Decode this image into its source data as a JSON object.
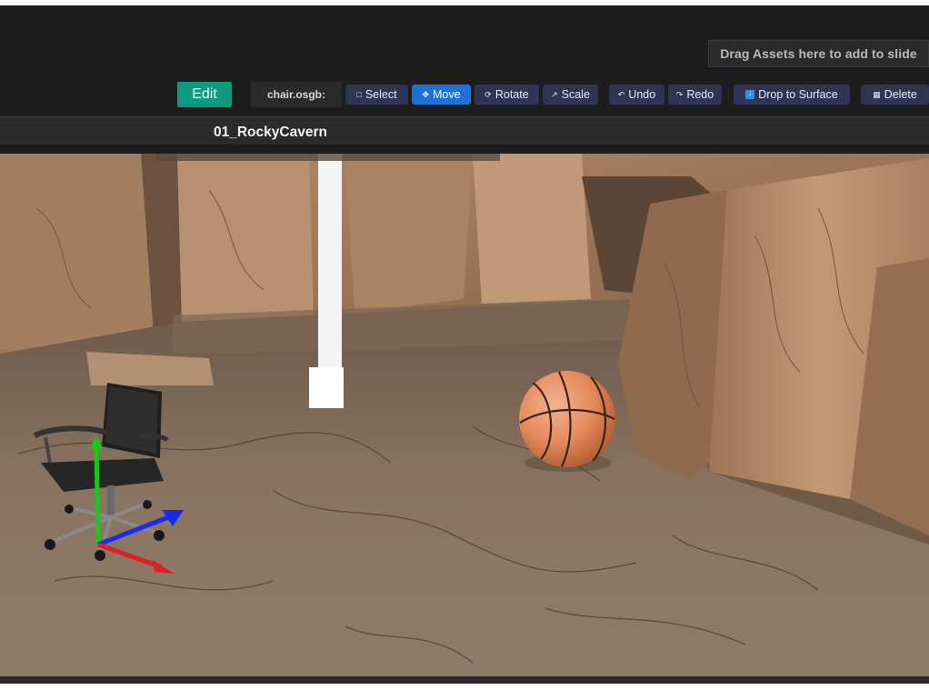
{
  "header": {
    "drop_zone_text": "Drag Assets here to add to slide"
  },
  "toolbar": {
    "edit_label": "Edit",
    "asset_name": "chair.osgb:",
    "buttons": [
      {
        "label": "Select",
        "icon": "select-box-icon"
      },
      {
        "label": "Move",
        "icon": "move-icon",
        "active": true
      },
      {
        "label": "Rotate",
        "icon": "rotate-icon"
      },
      {
        "label": "Scale",
        "icon": "scale-icon"
      },
      {
        "label": "Undo",
        "icon": "undo-icon"
      },
      {
        "label": "Redo",
        "icon": "redo-icon"
      },
      {
        "label": "Drop to Surface",
        "icon": "drop-to-surface-icon"
      },
      {
        "label": "Delete",
        "icon": "trash-icon"
      }
    ],
    "accent_color": "#0d9a80",
    "active_color": "#1c72d6",
    "button_color": "#2f3354"
  },
  "scene": {
    "title": "01_RockyCavern",
    "objects": [
      "office-chair",
      "basketball",
      "white-pillar"
    ],
    "gizmo": {
      "x_color": "#e02020",
      "y_color": "#18c818",
      "z_color": "#1a2ce8"
    }
  }
}
